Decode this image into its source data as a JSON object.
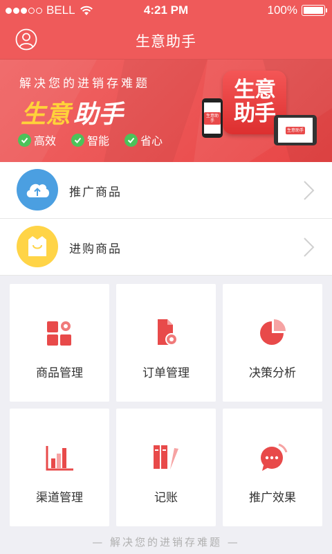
{
  "status_bar": {
    "carrier": "BELL",
    "time": "4:21 PM",
    "battery": "100%",
    "battery_level": 1.0,
    "signal_bars_filled": 3,
    "signal_bars_total": 5
  },
  "nav": {
    "title": "生意助手",
    "avatar_icon": "user-circle-icon"
  },
  "banner": {
    "slogan": "解决您的进销存难题",
    "headline_a": "生意",
    "headline_b": "助手",
    "features": [
      "高效",
      "智能",
      "省心"
    ],
    "logo_line1": "生意",
    "logo_line2": "助手",
    "mini_logo": "生意助手"
  },
  "list": [
    {
      "label": "推广商品",
      "icon": "cloud-upload-icon",
      "color": "#4b9fe1"
    },
    {
      "label": "进购商品",
      "icon": "shopping-bag-icon",
      "color": "#ffd447"
    }
  ],
  "grid": [
    {
      "label": "商品管理",
      "icon": "product-manage-icon"
    },
    {
      "label": "订单管理",
      "icon": "order-manage-icon"
    },
    {
      "label": "决策分析",
      "icon": "pie-chart-icon"
    },
    {
      "label": "渠道管理",
      "icon": "bar-chart-icon"
    },
    {
      "label": "记账",
      "icon": "ledger-icon"
    },
    {
      "label": "推广效果",
      "icon": "chat-bubble-icon"
    }
  ],
  "footer": "— 解决您的进销存难题 —",
  "colors": {
    "brand_red": "#ef5a5a",
    "icon_red": "#e84a4a",
    "accent_yellow": "#ffd23a",
    "check_green": "#4cc25a"
  }
}
